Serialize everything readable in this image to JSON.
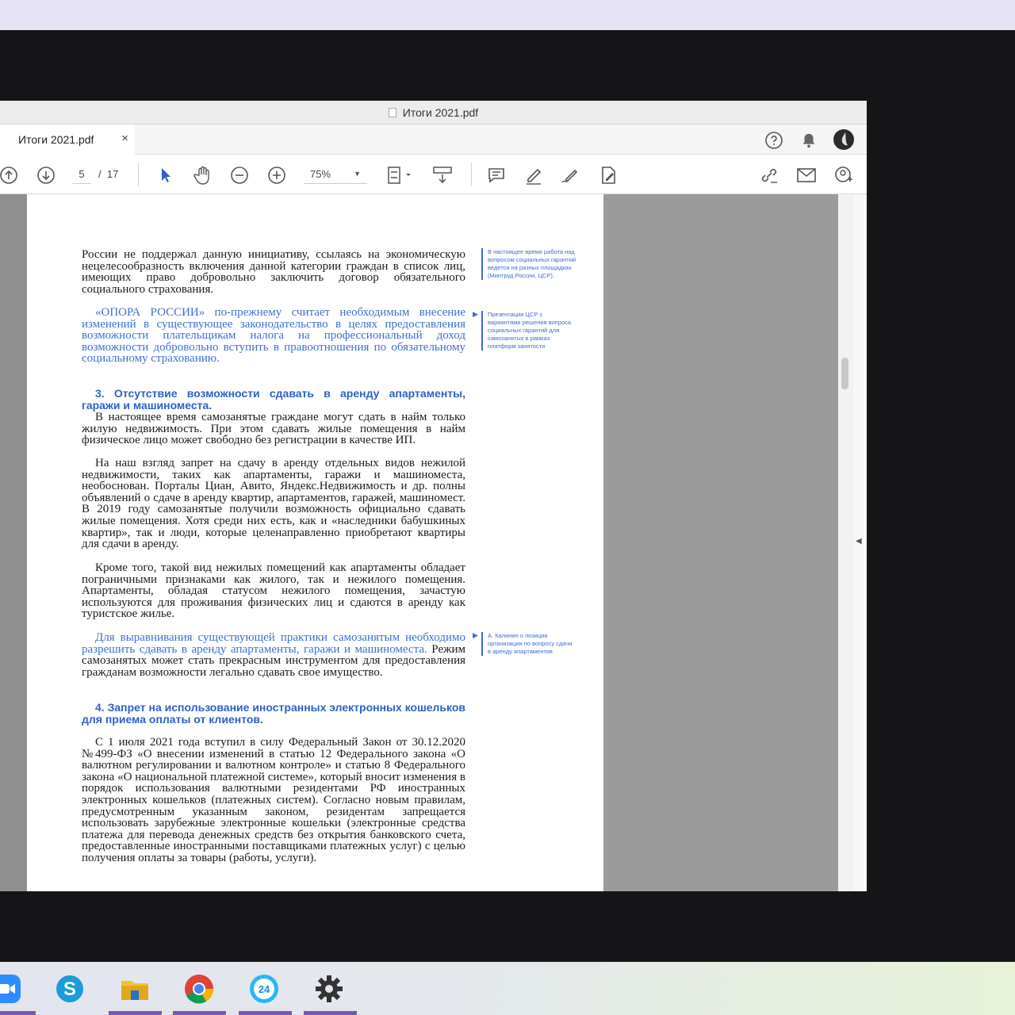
{
  "window": {
    "title": "Итоги 2021.pdf"
  },
  "tab": {
    "label": "Итоги 2021.pdf",
    "close": "×"
  },
  "header_icons": [
    "help-icon",
    "bell-icon",
    "avatar"
  ],
  "toolbar": {
    "page_current": "5",
    "page_sep": "/",
    "page_total": "17",
    "zoom": "75%",
    "tools": [
      "page-up-icon",
      "page-down-icon",
      "select-icon",
      "hand-icon",
      "zoom-out-icon",
      "zoom-in-icon",
      "fit-page-icon",
      "scroll-mode-icon",
      "comment-icon",
      "highlight-icon",
      "sign-icon",
      "edit-pdf-icon",
      "share-link-icon",
      "email-icon",
      "add-user-icon"
    ]
  },
  "document": {
    "p1": "России не поддержал данную инициативу, ссылаясь на экономическую нецелесообразность включения данной категории граждан в список лиц, имеющих право добровольно заключить договор обязательного социального страхования.",
    "p2": "«ОПОРА РОССИИ» по-прежнему считает необходимым внесение изменений в существующее законодательство в целях предоставления возможности плательщикам налога на профессиональный доход возможности добровольно вступить в правоотношения по обязательному социальному страхованию.",
    "h3": "3. Отсутствие возможности сдавать в аренду апартаменты, гаражи и машиноместа.",
    "p3": "В настоящее время самозанятые граждане могут сдать в найм только жилую недвижимость. При этом сдавать жилые помещения в найм физическое лицо может свободно без регистрации в качестве ИП.",
    "p4": "На наш взгляд запрет на сдачу в аренду отдельных видов нежилой недвижимости, таких как апартаменты, гаражи и машиноместа, необоснован. Порталы Циан, Авито, Яндекс.Недвижимость и др. полны объявлений о сдаче в аренду квартир, апартаментов, гаражей, машиномест. В 2019 году самозанятые получили возможность официально сдавать жилые помещения. Хотя среди них есть, как и «наследники бабушкиных квартир», так и люди, которые целенаправленно приобретают квартиры для сдачи в аренду.",
    "p5": "Кроме того, такой вид нежилых помещений как апартаменты обладает пограничными признаками как жилого, так и нежилого помещения. Апартаменты, обладая статусом нежилого помещения, зачастую используются для проживания физических лиц и сдаются в аренду как туристское жилье.",
    "p6_blue": "Для выравнивания существующей практики самозанятым необходимо разрешить сдавать в аренду апартаменты, гаражи и машиноместа.",
    "p6_rest": " Режим самозанятых может стать прекрасным инструментом для предоставления гражданам возможности легально сдавать свое имущество.",
    "h4": "4. Запрет на использование иностранных электронных кошельков для приема оплаты от клиентов.",
    "p7": "С 1 июля 2021 года вступил в силу Федеральный Закон от 30.12.2020 №499-ФЗ «О внесении изменений в статью 12 Федерального закона «О валютном регулировании и валютном контроле» и статью 8 Федерального закона «О национальной платежной системе», который вносит изменения в порядок использования валютными резидентами РФ иностранных электронных кошельков (платежных систем). Согласно новым правилам, предусмотренным указанным законом, резидентам запрещается использовать зарубежные электронные кошельки (электронные средства платежа для перевода денежных средств без открытия банковского счета, предоставленные иностранными поставщиками платежных услуг) с целью получения оплаты за товары (работы, услуги)."
  },
  "margin_notes": {
    "n1": "В настоящее время работа над вопросом социальных гарантий ведется на разных площадках (Минтруд России, ЦСР).",
    "n2": "Презентация ЦСР с вариантами решения вопроса социальных гарантий для самозанятых в рамках платформ занятости",
    "n3": "А. Калинин о позиции организации по вопросу сдачи в аренду апартаментов"
  },
  "taskbar": [
    "zoom-icon",
    "skype-icon",
    "file-manager-icon",
    "chrome-icon",
    "app-24-icon",
    "settings-gear-icon"
  ],
  "colors": {
    "accent_blue": "#3f6fd0",
    "heading_blue": "#2f61c7",
    "taskbar_underline": "#7559b4"
  }
}
